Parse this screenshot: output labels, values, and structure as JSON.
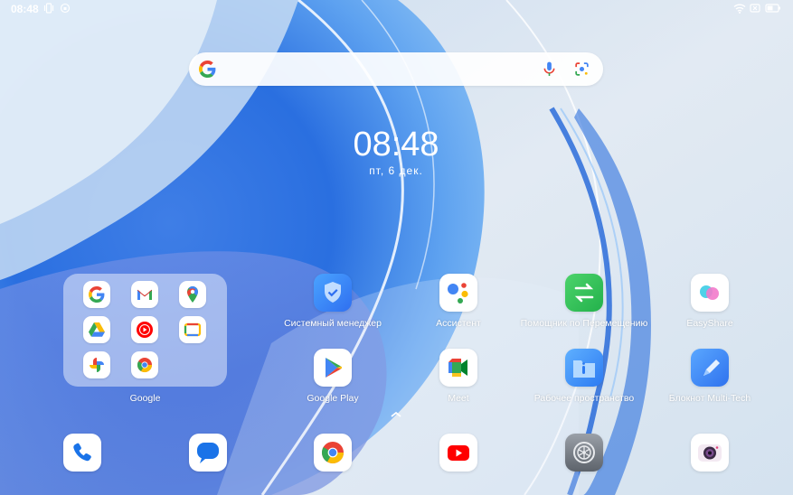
{
  "status_bar": {
    "time": "08:48",
    "left_icons": [
      "vibrate-icon",
      "rotation-lock-icon"
    ],
    "right_icons": [
      "wifi-icon",
      "no-sim-icon",
      "battery-icon"
    ]
  },
  "search": {
    "logo": "google-g-icon",
    "right_icons": [
      "microphone-icon",
      "google-lens-icon"
    ]
  },
  "clock": {
    "time": "08:48",
    "date": "пт, 6 дек."
  },
  "folder": {
    "label": "Google",
    "apps": [
      "google-icon",
      "gmail-icon",
      "maps-icon",
      "drive-icon",
      "youtube-music-icon",
      "google-tv-icon",
      "photos-icon",
      "chrome-icon"
    ]
  },
  "apps": [
    {
      "label": "Системный менеджер",
      "icon": "system-manager-icon"
    },
    {
      "label": "Ассистент",
      "icon": "assistant-icon"
    },
    {
      "label": "Помощник по Перемещению",
      "icon": "transfer-assistant-icon"
    },
    {
      "label": "EasyShare",
      "icon": "easyshare-icon"
    },
    {
      "label": "Google Play",
      "icon": "google-play-icon"
    },
    {
      "label": "Meet",
      "icon": "meet-icon"
    },
    {
      "label": "Рабочее пространство",
      "icon": "workspace-icon"
    },
    {
      "label": "Блокнот Multi-Tech",
      "icon": "notes-icon"
    }
  ],
  "dock": [
    "phone-icon",
    "messages-icon",
    "chrome-icon",
    "youtube-icon",
    "settings-icon",
    "camera-icon"
  ],
  "colors": {
    "google_blue": "#4285F4",
    "google_red": "#EA4335",
    "google_yellow": "#FBBC05",
    "google_green": "#34A853"
  }
}
